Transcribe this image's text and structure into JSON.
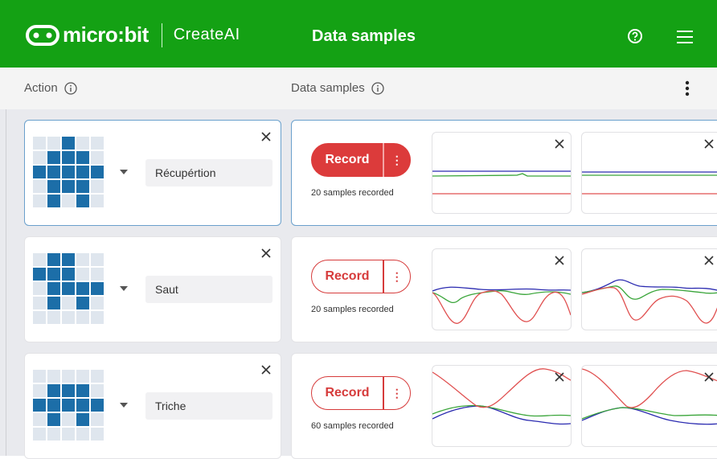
{
  "header": {
    "brand": "micro:bit",
    "product": "CreateAI",
    "title": "Data samples"
  },
  "columns": {
    "action": "Action",
    "data_samples": "Data samples"
  },
  "record_label": "Record",
  "colors": {
    "brand_green": "#14a114",
    "record_red": "#dc3b3b",
    "led_on": "#1c6ea8"
  },
  "rows": [
    {
      "name": "Récupértion",
      "samples_text": "20 samples recorded",
      "record_filled": true,
      "led": [
        0,
        0,
        1,
        0,
        0,
        0,
        1,
        1,
        1,
        0,
        1,
        1,
        1,
        1,
        1,
        0,
        1,
        1,
        1,
        0,
        0,
        1,
        0,
        1,
        0
      ]
    },
    {
      "name": "Saut",
      "samples_text": "20 samples recorded",
      "record_filled": false,
      "led": [
        0,
        1,
        1,
        0,
        0,
        1,
        1,
        1,
        0,
        0,
        0,
        1,
        1,
        1,
        1,
        0,
        1,
        0,
        1,
        0,
        0,
        0,
        0,
        0,
        0
      ]
    },
    {
      "name": "Triche",
      "samples_text": "60 samples recorded",
      "record_filled": false,
      "led": [
        0,
        0,
        0,
        0,
        0,
        0,
        1,
        1,
        1,
        0,
        1,
        1,
        1,
        1,
        1,
        0,
        1,
        0,
        1,
        0,
        0,
        0,
        0,
        0,
        0
      ]
    }
  ]
}
